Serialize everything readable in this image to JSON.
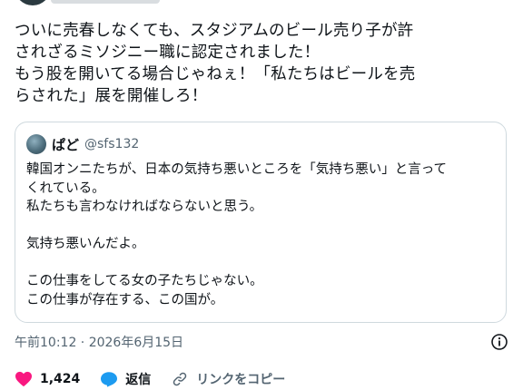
{
  "tweet": {
    "text": "ついに売春しなくても、スタジアムのビール売り子が許\nされざるミソジニー職に認定されました！\nもう股を開いてる場合じゃねぇ！「私たちはビールを売\nらされた」展を開催しろ！"
  },
  "quote": {
    "name": "ぱど",
    "handle": "@sfs132",
    "text": "韓国オンニたちが、日本の気持ち悪いところを「気持ち悪い」と言って\nくれている。\n私たちも言わなければならないと思う。\n\n気持ち悪いんだよ。\n\nこの仕事をしてる女の子たちじゃない。\nこの仕事が存在する、この国が。"
  },
  "meta": {
    "timestamp": "午前10:12 · 2026年6月15日"
  },
  "actions": {
    "like_count": "1,424",
    "reply_label": "返信",
    "copy_link_label": "リンクをコピー"
  },
  "colors": {
    "like": "#f91880",
    "reply": "#1d9bf0",
    "muted": "#536471",
    "border": "#cfd9de"
  }
}
